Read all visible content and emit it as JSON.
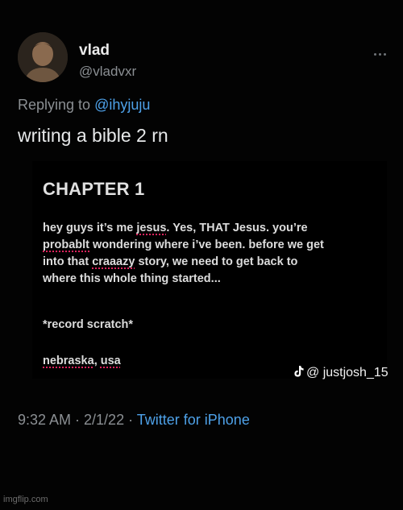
{
  "author": {
    "display_name": "vlad",
    "handle": "@vladvxr",
    "avatar_icon": "profile-photo-icon"
  },
  "reply": {
    "prefix": "Replying to",
    "mention": "@ihyjuju"
  },
  "tweet": {
    "text": "writing a bible 2 rn"
  },
  "attachment": {
    "heading": "CHAPTER 1",
    "p1": {
      "l1a": "hey guys it’s me ",
      "l1b": "jesus",
      "l1c": ". Yes, THAT Jesus. you’re",
      "l2a": "probablt",
      "l2b": " wondering where i’ve been. before we get",
      "l3a": "into that ",
      "l3b": "craaazy",
      "l3c": " story, we need to get back to",
      "l4": "where this whole thing started..."
    },
    "record": "*record scratch*",
    "place_a": "nebraska",
    "place_b": ", ",
    "place_c": "usa"
  },
  "watermark": {
    "icon": "tiktok-icon",
    "text": "@ justjosh_15"
  },
  "meta": {
    "time_date": "9:32 AM · 2/1/22 · ",
    "source": "Twitter for iPhone"
  },
  "footer": {
    "site": "imgflip.com"
  },
  "colors": {
    "background": "#030303",
    "link": "#4ea1e8",
    "secondary_text": "#8b8f93",
    "spellcheck": "#e0245e"
  }
}
